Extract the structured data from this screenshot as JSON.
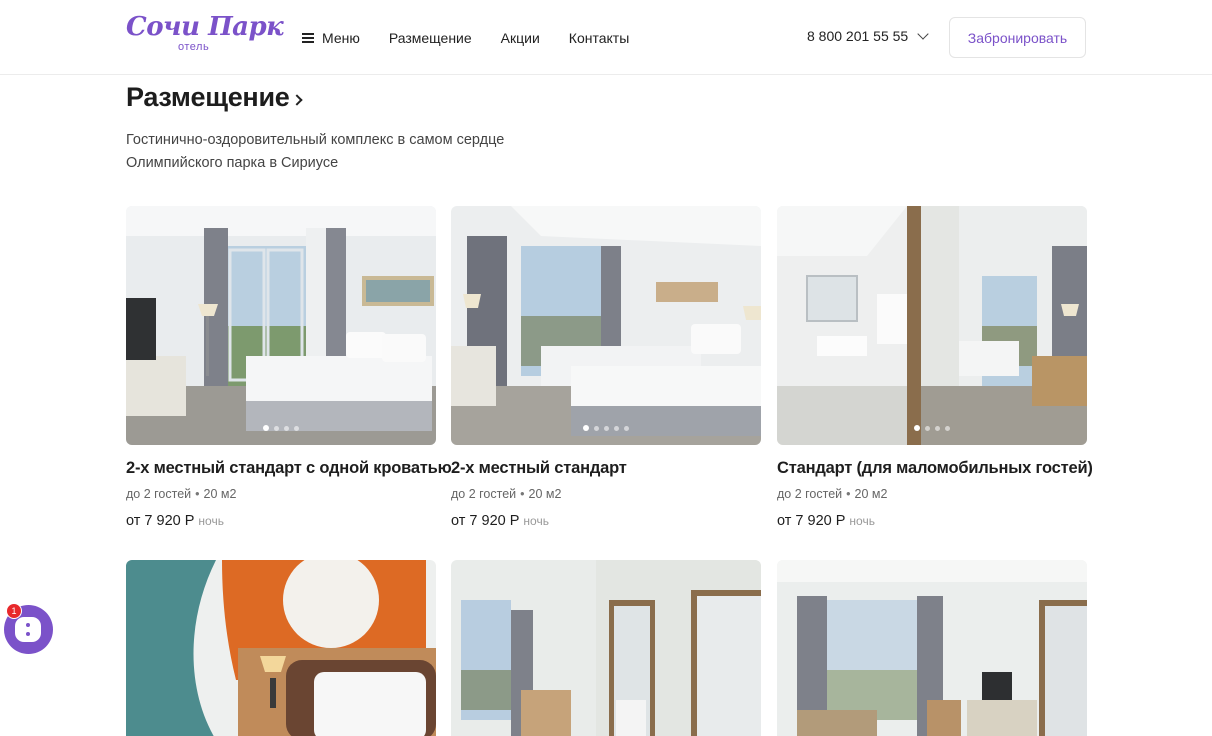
{
  "header": {
    "logo_main": "Сочи Парк",
    "logo_sub": "отель",
    "nav": [
      {
        "label": "Меню",
        "icon": "burger-icon"
      },
      {
        "label": "Размещение"
      },
      {
        "label": "Акции"
      },
      {
        "label": "Контакты"
      }
    ],
    "phone": "8 800 201 55 55",
    "book_label": "Забронировать"
  },
  "page": {
    "title": "Размещение",
    "subtitle": "Гостинично-оздоровительный комплекс в самом сердце Олимпийского парка в Сириусе"
  },
  "rooms": [
    {
      "title": "2-х местный стандарт с одной кроватью",
      "guests": "до 2 гостей",
      "area": "20 м2",
      "price": "от 7 920 Р",
      "price_unit": "ночь",
      "photos_count": 4,
      "active_photo": 1
    },
    {
      "title": "2-х местный стандарт",
      "guests": "до 2 гостей",
      "area": "20 м2",
      "price": "от 7 920 Р",
      "price_unit": "ночь",
      "photos_count": 5,
      "active_photo": 1
    },
    {
      "title": "Стандарт (для маломобильных гостей)",
      "guests": "до 2 гостей",
      "area": "20 м2",
      "price": "от 7 920 Р",
      "price_unit": "ночь",
      "photos_count": 4,
      "active_photo": 1
    }
  ],
  "chat": {
    "badge": "1"
  },
  "colors": {
    "accent": "#7b52c9",
    "badge": "#e8282b",
    "text": "#1e1e1e"
  }
}
